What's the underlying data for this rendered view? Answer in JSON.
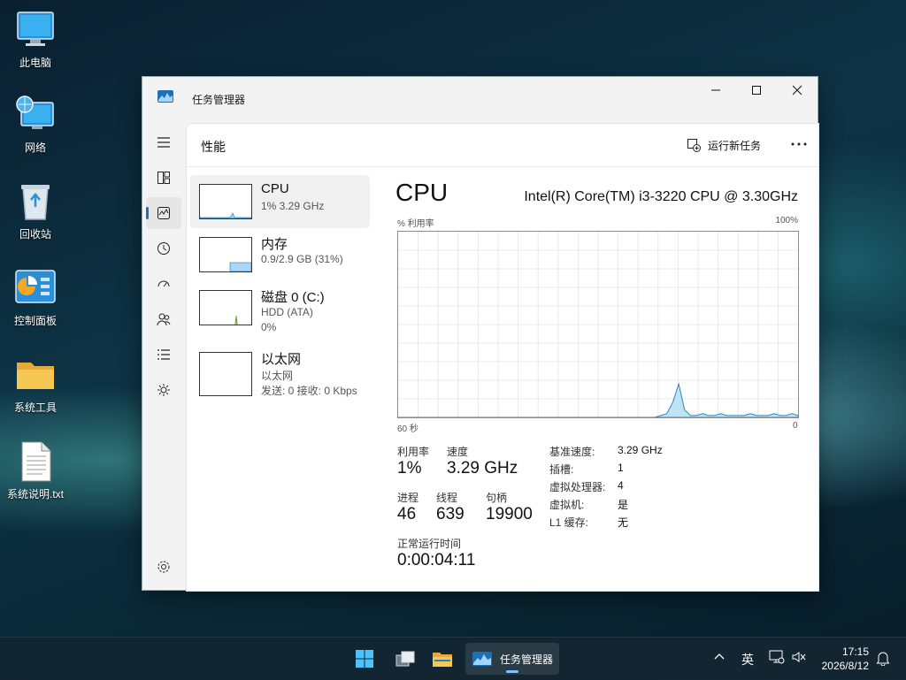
{
  "desktop": {
    "icons": [
      {
        "label": "此电脑",
        "icon": "computer-icon"
      },
      {
        "label": "网络",
        "icon": "network-icon"
      },
      {
        "label": "回收站",
        "icon": "recycle-bin-icon"
      },
      {
        "label": "控制面板",
        "icon": "control-panel-icon"
      },
      {
        "label": "系统工具",
        "icon": "folder-icon"
      },
      {
        "label": "系统说明.txt",
        "icon": "text-file-icon"
      }
    ]
  },
  "window": {
    "title": "任务管理器",
    "page_title": "性能",
    "run_new_task": "运行新任务",
    "nav": [
      "hamburger-icon",
      "processes-icon",
      "performance-icon",
      "app-history-icon",
      "startup-icon",
      "users-icon",
      "details-icon",
      "services-icon",
      "settings-icon"
    ]
  },
  "devices": [
    {
      "name": "CPU",
      "sub1": "1% 3.29 GHz"
    },
    {
      "name": "内存",
      "sub1": "0.9/2.9 GB (31%)"
    },
    {
      "name": "磁盘 0 (C:)",
      "sub1": "HDD (ATA)",
      "sub2": "0%"
    },
    {
      "name": "以太网",
      "sub1": "以太网",
      "sub2": "发送: 0 接收: 0 Kbps"
    }
  ],
  "cpu": {
    "title": "CPU",
    "model": "Intel(R) Core(TM) i3-3220 CPU @ 3.30GHz",
    "y_label": "% 利用率",
    "y_max": "100%",
    "x_left": "60 秒",
    "x_right": "0",
    "utilization_label": "利用率",
    "utilization": "1%",
    "speed_label": "速度",
    "speed": "3.29 GHz",
    "processes_label": "进程",
    "processes": "46",
    "threads_label": "线程",
    "threads": "639",
    "handles_label": "句柄",
    "handles": "19900",
    "uptime_label": "正常运行时间",
    "uptime": "0:00:04:11",
    "details": [
      {
        "k": "基准速度:",
        "v": "3.29 GHz"
      },
      {
        "k": "插槽:",
        "v": "1"
      },
      {
        "k": "虚拟处理器:",
        "v": "4"
      },
      {
        "k": "虚拟机:",
        "v": "是"
      },
      {
        "k": "L1 缓存:",
        "v": "无"
      }
    ],
    "history": [
      0,
      0,
      0,
      0,
      0,
      0,
      0,
      0,
      0,
      0,
      0,
      0,
      0,
      0,
      0,
      0,
      0,
      0,
      0,
      0,
      0,
      0,
      0,
      0,
      0,
      0,
      0,
      0,
      0,
      0,
      0,
      0,
      0,
      0,
      0,
      0,
      0,
      0,
      0,
      0,
      0,
      0,
      0,
      0,
      1,
      2,
      8,
      18,
      4,
      1,
      1,
      2,
      1,
      1,
      2,
      1,
      1,
      1,
      1,
      2,
      1,
      1,
      1,
      2,
      1,
      1,
      2,
      1
    ]
  },
  "taskbar": {
    "active_app": "任务管理器",
    "ime": "英",
    "time": "17:15",
    "date": "2026/8/12"
  }
}
